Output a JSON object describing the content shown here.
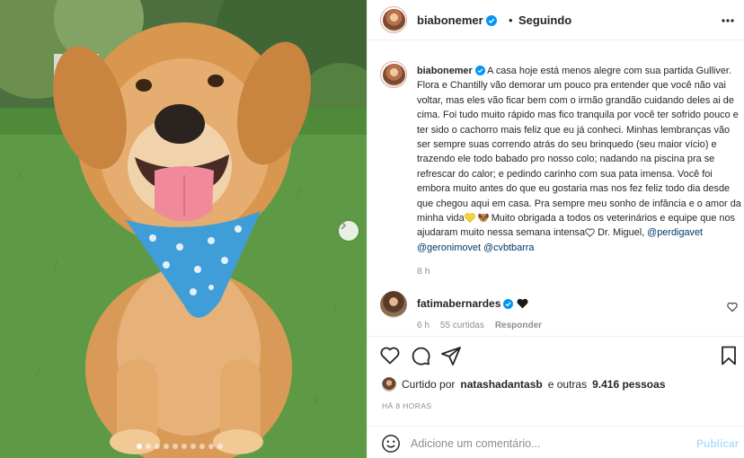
{
  "post": {
    "username": "biabonemer",
    "separator": "•",
    "follow_status": "Seguindo",
    "carousel": {
      "total_slides": 10,
      "active_slide": 1
    },
    "caption_parts": {
      "p1": "A casa hoje está menos alegre com sua partida Gulliver. Flora e Chantilly vão demorar um pouco pra entender que você não vai voltar, mas eles vão ficar bem com o irmão grandão cuidando deles ai de cima. Foi tudo muito rápido mas fico tranquila por você ter sofrido pouco e ter sido o cachorro mais feliz que eu já conheci. Minhas lembranças vão ser sempre suas correndo atrás do seu brinquedo (seu maior vício) e trazendo ele todo babado pro nosso colo; nadando na piscina pra se refrescar do calor; e pedindo carinho com sua pata imensa. Você foi embora muito antes do que eu gostaria mas nos fez feliz todo dia desde que chegou aqui em casa. Pra sempre meu sonho de infância e o amor da minha vida",
      "p2": " Muito obrigada a todos os veterinários e equipe que nos ajudaram muito nessa semana intensa",
      "p3": "  Dr. Miguel, ",
      "mention1": "@perdigavet",
      "mention2": "@geronimovet",
      "mention3": "@cvbtbarra"
    },
    "caption_time": "8 h",
    "comment": {
      "username": "fatimabernardes",
      "time": "6 h",
      "likes": "55 curtidas",
      "reply": "Responder"
    },
    "liked_by_prefix": "Curtido por",
    "liked_by_user": "natashadantasb",
    "liked_by_suffix": "e outras",
    "liked_by_count": "9.416 pessoas",
    "posted_ago": "HÁ 8 HORAS",
    "add_comment_placeholder": "Adicione um comentário...",
    "publish_label": "Publicar"
  },
  "colors": {
    "verified_blue": "#0095f6",
    "mention_blue": "#00376b",
    "publish_disabled": "#b2dffc",
    "bandana_blue": "#3f9ed8",
    "grass_green": "#5e9a45"
  },
  "icons": [
    "verified-icon",
    "more-options-icon",
    "heart-icon",
    "comment-icon",
    "share-icon",
    "bookmark-icon",
    "emoji-icon",
    "chevron-right-icon",
    "yellow-heart-emoji",
    "dog-emoji",
    "white-heart-emoji",
    "black-heart-emoji"
  ]
}
